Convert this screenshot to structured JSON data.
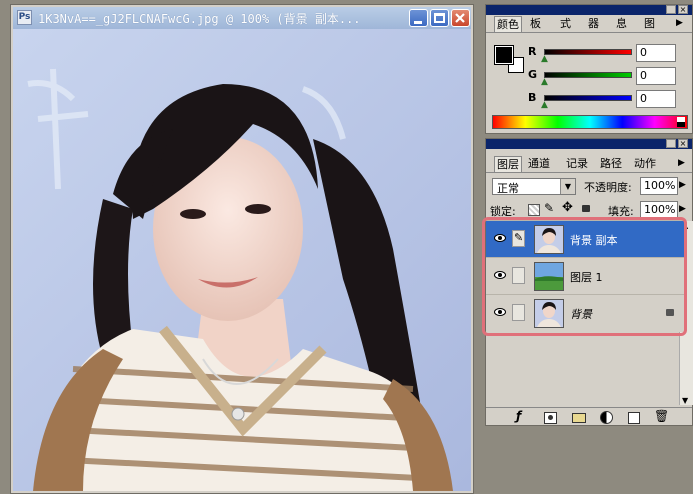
{
  "document": {
    "title": "1K3NvA==_gJ2FLCNAFwcG.jpg @ 100% (背景 副本..."
  },
  "color_panel": {
    "tabs": [
      "颜色",
      "板",
      "式",
      "器",
      "息",
      "图"
    ],
    "channels": [
      {
        "label": "R",
        "value": "0",
        "color": "#cc1e1e"
      },
      {
        "label": "G",
        "value": "0",
        "color": "#1a9a1a"
      },
      {
        "label": "B",
        "value": "0",
        "color": "#1830c8"
      }
    ],
    "foreground": "#000000",
    "background": "#ffffff"
  },
  "layers_panel": {
    "tabs": [
      "图层",
      "通道",
      "记录",
      "路径",
      "动作"
    ],
    "blend_mode": "正常",
    "opacity_label": "不透明度:",
    "opacity_value": "100%",
    "lock_label": "锁定:",
    "fill_label": "填充:",
    "fill_value": "100%",
    "layers": [
      {
        "name": "背景 副本",
        "selected": true,
        "thumbnail": "portrait"
      },
      {
        "name": "图层 1",
        "selected": false,
        "thumbnail": "landscape"
      },
      {
        "name": "背景",
        "selected": false,
        "thumbnail": "portrait",
        "locked": true
      }
    ],
    "highlight_color": "#e0707a"
  }
}
